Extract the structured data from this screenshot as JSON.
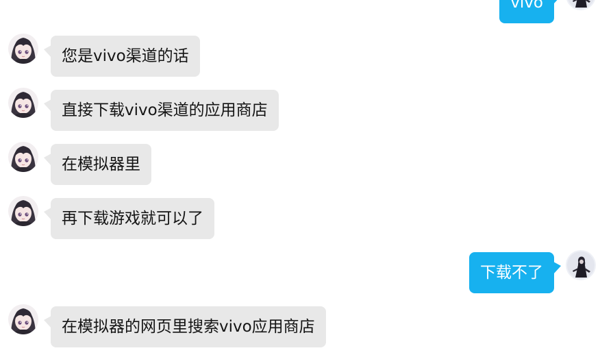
{
  "conversation": {
    "messages": [
      {
        "side": "out",
        "text": "vivo"
      },
      {
        "side": "in",
        "text": "您是vivo渠道的话"
      },
      {
        "side": "in",
        "text": "直接下载vivo渠道的应用商店"
      },
      {
        "side": "in",
        "text": "在模拟器里"
      },
      {
        "side": "in",
        "text": "再下载游戏就可以了"
      },
      {
        "side": "out",
        "text": "下载不了"
      },
      {
        "side": "in",
        "text": "在模拟器的网页里搜索vivo应用商店"
      }
    ]
  },
  "colors": {
    "incoming_bubble": "#e8e8e8",
    "outgoing_bubble": "#17b1ef",
    "incoming_text": "#141414",
    "outgoing_text": "#ffffff"
  },
  "icons": {
    "incoming_avatar": "anime-girl-avatar-icon",
    "outgoing_avatar": "dark-figure-avatar-icon"
  }
}
